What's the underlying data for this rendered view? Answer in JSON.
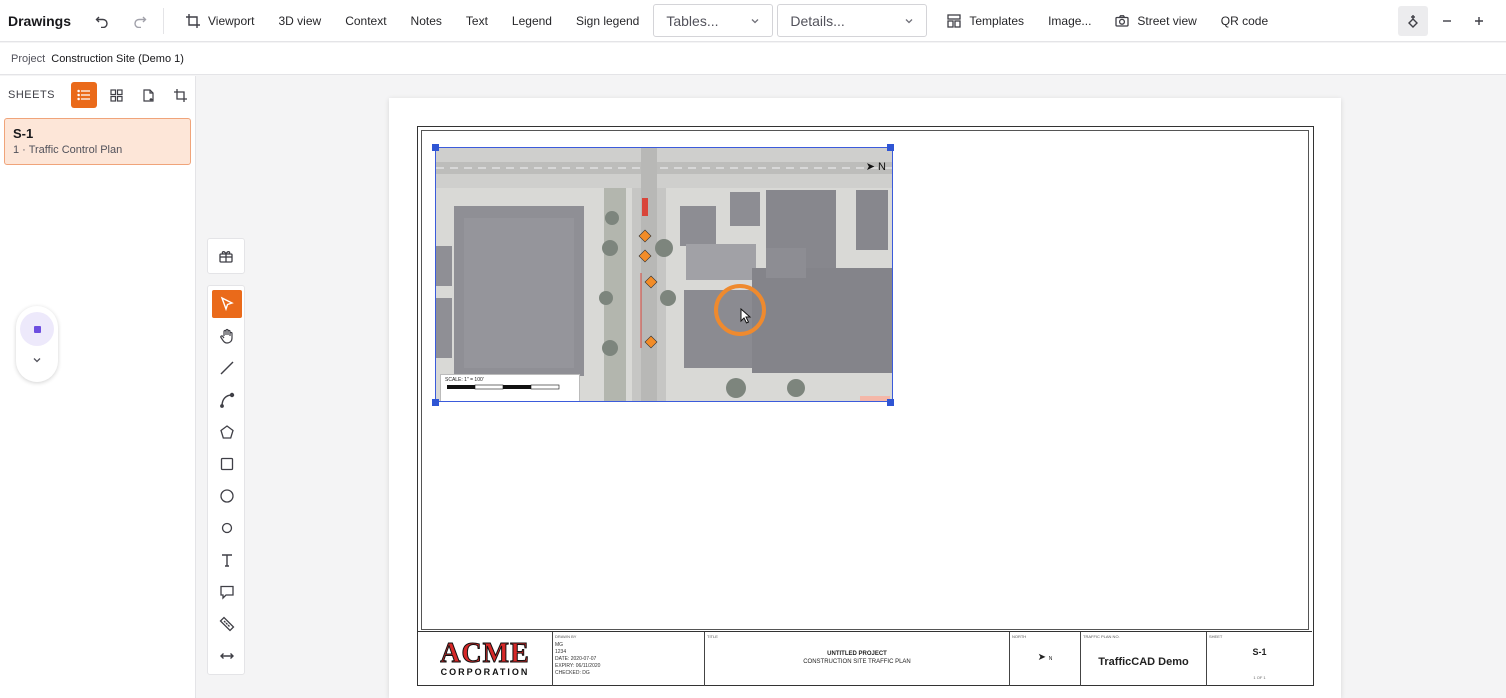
{
  "toolbar": {
    "app_title": "Drawings",
    "items": [
      "Viewport",
      "3D view",
      "Context",
      "Notes",
      "Text",
      "Legend",
      "Sign legend"
    ],
    "tables_select": "Tables...",
    "details_select": "Details...",
    "templates": "Templates",
    "image": "Image...",
    "street_view": "Street view",
    "qr_code": "QR code"
  },
  "breadcrumb": {
    "label": "Project",
    "value": "Construction Site (Demo 1)"
  },
  "sidebar": {
    "title": "SHEETS",
    "sheets": [
      {
        "code": "S-1",
        "name": "1 · Traffic Control Plan"
      }
    ]
  },
  "map": {
    "north_label": "N",
    "scale_label": "SCALE: 1\" = 100'"
  },
  "titleblock": {
    "logo_main": "ACME",
    "logo_sub": "CORPORATION",
    "drawn_header": "DRAWN BY",
    "drawn_lines": [
      "MG",
      "1234",
      "DATE: 2020-07-07",
      "EXPIRY: 06/11/2020",
      "CHECKED: DG"
    ],
    "title_header": "TITLE",
    "project_title": "UNTITLED PROJECT",
    "project_subtitle": "CONSTRUCTION SITE TRAFFIC PLAN",
    "north_header": "NORTH",
    "north_label": "N",
    "plan_header": "TRAFFIC PLAN NO.",
    "plan_name": "TrafficCAD Demo",
    "sheet_header": "SHEET",
    "sheet_no": "S-1",
    "sheet_of": "1 OF 1"
  },
  "colors": {
    "accent": "#ea6a1a",
    "selection": "#2f55d4",
    "cursor_ring": "#ef8a2e"
  }
}
